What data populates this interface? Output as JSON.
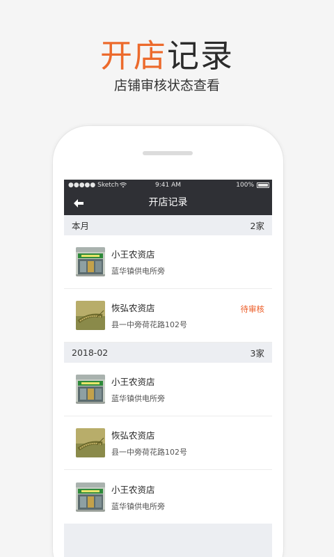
{
  "hero": {
    "title_accent": "开店",
    "title_rest": "记录",
    "subtitle": "店铺审核状态查看"
  },
  "statusbar": {
    "carrier": "●●●●● Sketch",
    "time": "9:41 AM",
    "battery": "100%"
  },
  "navbar": {
    "title": "开店记录"
  },
  "sections": [
    {
      "label": "本月",
      "count": "2家",
      "stores": [
        {
          "name": "小王农资店",
          "address": "蓝华镇供电所旁",
          "status": "",
          "thumb": "storefront"
        },
        {
          "name": "恢弘农资店",
          "address": "县一中旁荷花路102号",
          "status": "待审核",
          "thumb": "wheat"
        }
      ]
    },
    {
      "label": "2018-02",
      "count": "3家",
      "stores": [
        {
          "name": "小王农资店",
          "address": "蓝华镇供电所旁",
          "status": "",
          "thumb": "storefront"
        },
        {
          "name": "恢弘农资店",
          "address": "县一中旁荷花路102号",
          "status": "",
          "thumb": "wheat"
        },
        {
          "name": "小王农资店",
          "address": "蓝华镇供电所旁",
          "status": "",
          "thumb": "storefront"
        }
      ]
    }
  ],
  "colors": {
    "accent": "#ec6a2c",
    "pending": "#ec5a24",
    "bar": "#2f3035"
  }
}
